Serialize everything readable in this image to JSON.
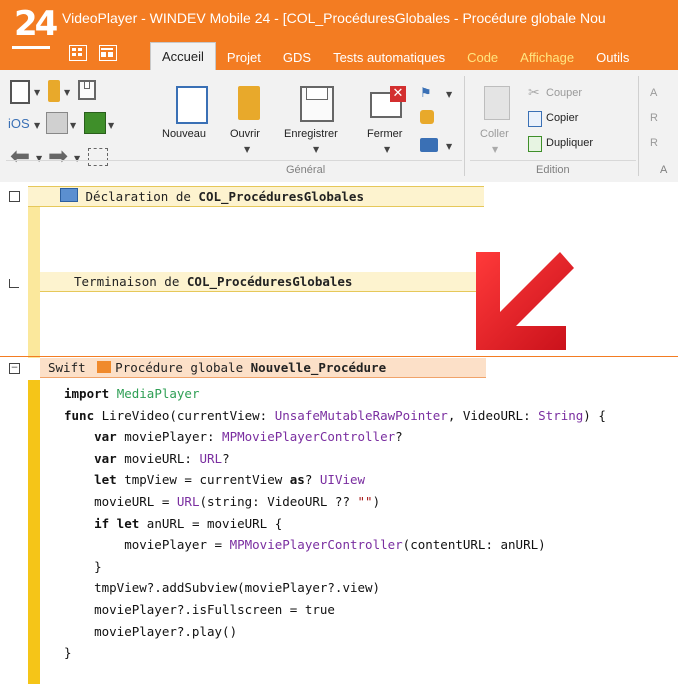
{
  "app": {
    "logo": "24",
    "title": "VideoPlayer - WINDEV Mobile 24 - [COL_ProcéduresGlobales - Procédure globale Nou"
  },
  "tabs": [
    {
      "label": "Accueil",
      "active": true
    },
    {
      "label": "Projet"
    },
    {
      "label": "GDS"
    },
    {
      "label": "Tests automatiques"
    },
    {
      "label": "Code"
    },
    {
      "label": "Affichage"
    },
    {
      "label": "Outils"
    }
  ],
  "ribbon": {
    "general": {
      "buttons": {
        "nouveau": "Nouveau",
        "ouvrir": "Ouvrir",
        "enregistrer": "Enregistrer",
        "fermer": "Fermer"
      },
      "group_label": "Général",
      "ios_label": "iOS"
    },
    "edition": {
      "coller": "Coller",
      "couper": "Couper",
      "copier": "Copier",
      "dupliquer": "Dupliquer",
      "group_label": "Edition"
    },
    "next_group_partial": {
      "label": "A",
      "items": [
        "A",
        "R",
        "R"
      ]
    }
  },
  "editor": {
    "sections": [
      {
        "prefix": "Déclaration de ",
        "name": "COL_ProcéduresGlobales"
      },
      {
        "prefix": "Terminaison de ",
        "name": "COL_ProcéduresGlobales"
      },
      {
        "lang": "Swift",
        "prefix": "Procédure globale ",
        "name": "Nouvelle_Procédure"
      }
    ],
    "code_lines": [
      "import MediaPlayer",
      "",
      "func LireVideo(currentView: UnsafeMutableRawPointer, VideoURL: String) {",
      "    var moviePlayer: MPMoviePlayerController?",
      "    var movieURL: URL?",
      "    let tmpView = currentView as? UIView",
      "    movieURL = URL(string: VideoURL ?? \"\")",
      "    if let anURL = movieURL {",
      "        moviePlayer = MPMoviePlayerController(contentURL: anURL)",
      "    }",
      "    tmpView?.addSubview(moviePlayer?.view)",
      "    moviePlayer?.isFullscreen = true",
      "    moviePlayer?.play()",
      "}"
    ]
  },
  "colors": {
    "accent": "#f37c22",
    "gutter_bar": "#f5c518",
    "section_header": "#fdf3cf",
    "swift_header": "#fce0c8",
    "annotation_arrow": "#e0202a"
  }
}
